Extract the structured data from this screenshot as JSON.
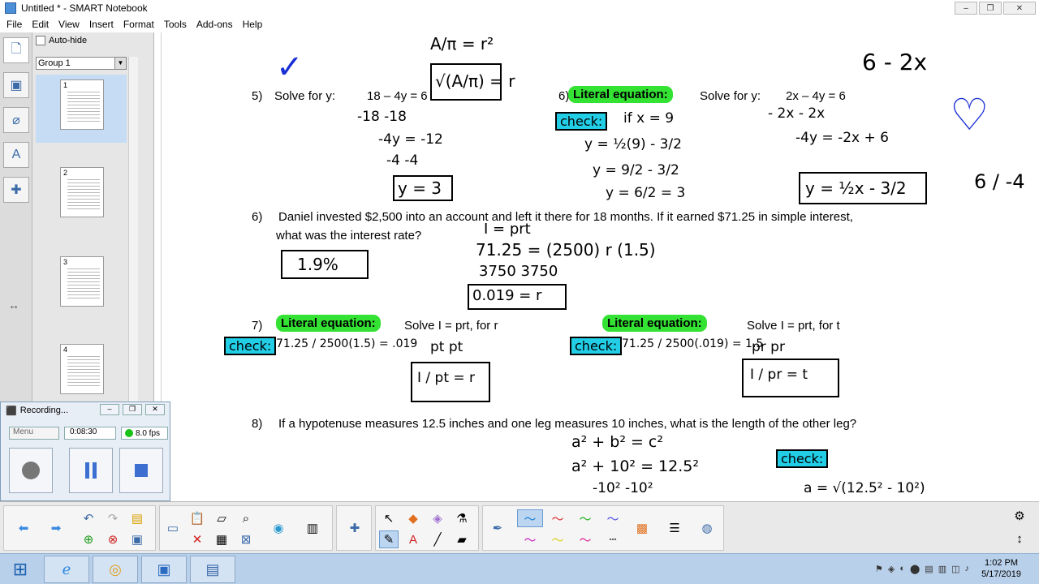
{
  "window": {
    "title": "Untitled * - SMART Notebook",
    "minimize": "‒",
    "maximize": "❐",
    "close": "✕"
  },
  "menu": [
    "File",
    "Edit",
    "View",
    "Insert",
    "Format",
    "Tools",
    "Add-ons",
    "Help"
  ],
  "sorter": {
    "autohide_label": "Auto-hide",
    "group_label": "Group 1",
    "pages": [
      {
        "num": "1"
      },
      {
        "num": "2"
      },
      {
        "num": "3"
      },
      {
        "num": "4"
      }
    ]
  },
  "canvas": {
    "p5_num": "5)",
    "p5_text": "Solve for y:",
    "p5_eq": "18 – 4y = 6",
    "p6a_num": "6)",
    "p6a_highlight": "Literal equation:",
    "p6a_text": "Solve for y:",
    "p6a_eq": "2x – 4y = 6",
    "p6_num": "6)",
    "p6_line1": "Daniel invested $2,500 into an account and left it there for 18 months.  If it earned $71.25 in simple interest,",
    "p6_line2": "what was the interest rate?",
    "p7_num": "7)",
    "p7_highlight1": "Literal equation:",
    "p7_solve1": "Solve I = prt,  for r",
    "p7_highlight2": "Literal equation:",
    "p7_solve2": "Solve I = prt,  for t",
    "p8_num": "8)",
    "p8_text": "If a hypotenuse measures 12.5 inches and one leg measures 10 inches, what is the length of the other leg?",
    "check_label": "check:",
    "hw_top": "A/π = r²",
    "hw_a_over_pi": "√(A/π) = r",
    "hw_6_2x": "6 - 2x",
    "hw_minus18": "-18   -18",
    "hw_minus4y": "-4y = -12",
    "hw_minus4": "-4   -4",
    "hw_y3": "y = 3",
    "hw_ifx9": "if x = 9",
    "hw_l1": "y = ½(9) - 3/2",
    "hw_l2": "y = 9/2 - 3/2",
    "hw_l3": "y = 6/2 = 3",
    "hw_minus2x": "- 2x      - 2x",
    "hw_4y": "-4y = -2x + 6",
    "hw_result": "y = ½x - 3/2",
    "hw_frac": "6 / -4",
    "hw_iprt": "I = prt",
    "hw_eq1": "71.25 = (2500) r (1.5)",
    "hw_3750": "3750       3750",
    "hw_019": "0.019 = r",
    "hw_19pct": "1.9%",
    "hw_check1": "71.25 / 2500(1.5) = .019",
    "hw_ptpt": "pt   pt",
    "hw_Ipt": "I / pt = r",
    "hw_check2": "71.25 / 2500(.019) = 1.5",
    "hw_prpr": "pr   pr",
    "hw_Ipr": "I / pr = t",
    "hw_a2b2": "a² + b² = c²",
    "hw_a2_10": "a² + 10² = 12.5²",
    "hw_sub": "-10²     -10²",
    "hw_sqrt": "a = √(12.5² - 10²)"
  },
  "recorder": {
    "title": "Recording...",
    "menu": "Menu",
    "time": "0:08:30",
    "fps": "8.0 fps"
  },
  "taskbar": {
    "time": "1:02 PM",
    "date": "5/17/2019"
  }
}
